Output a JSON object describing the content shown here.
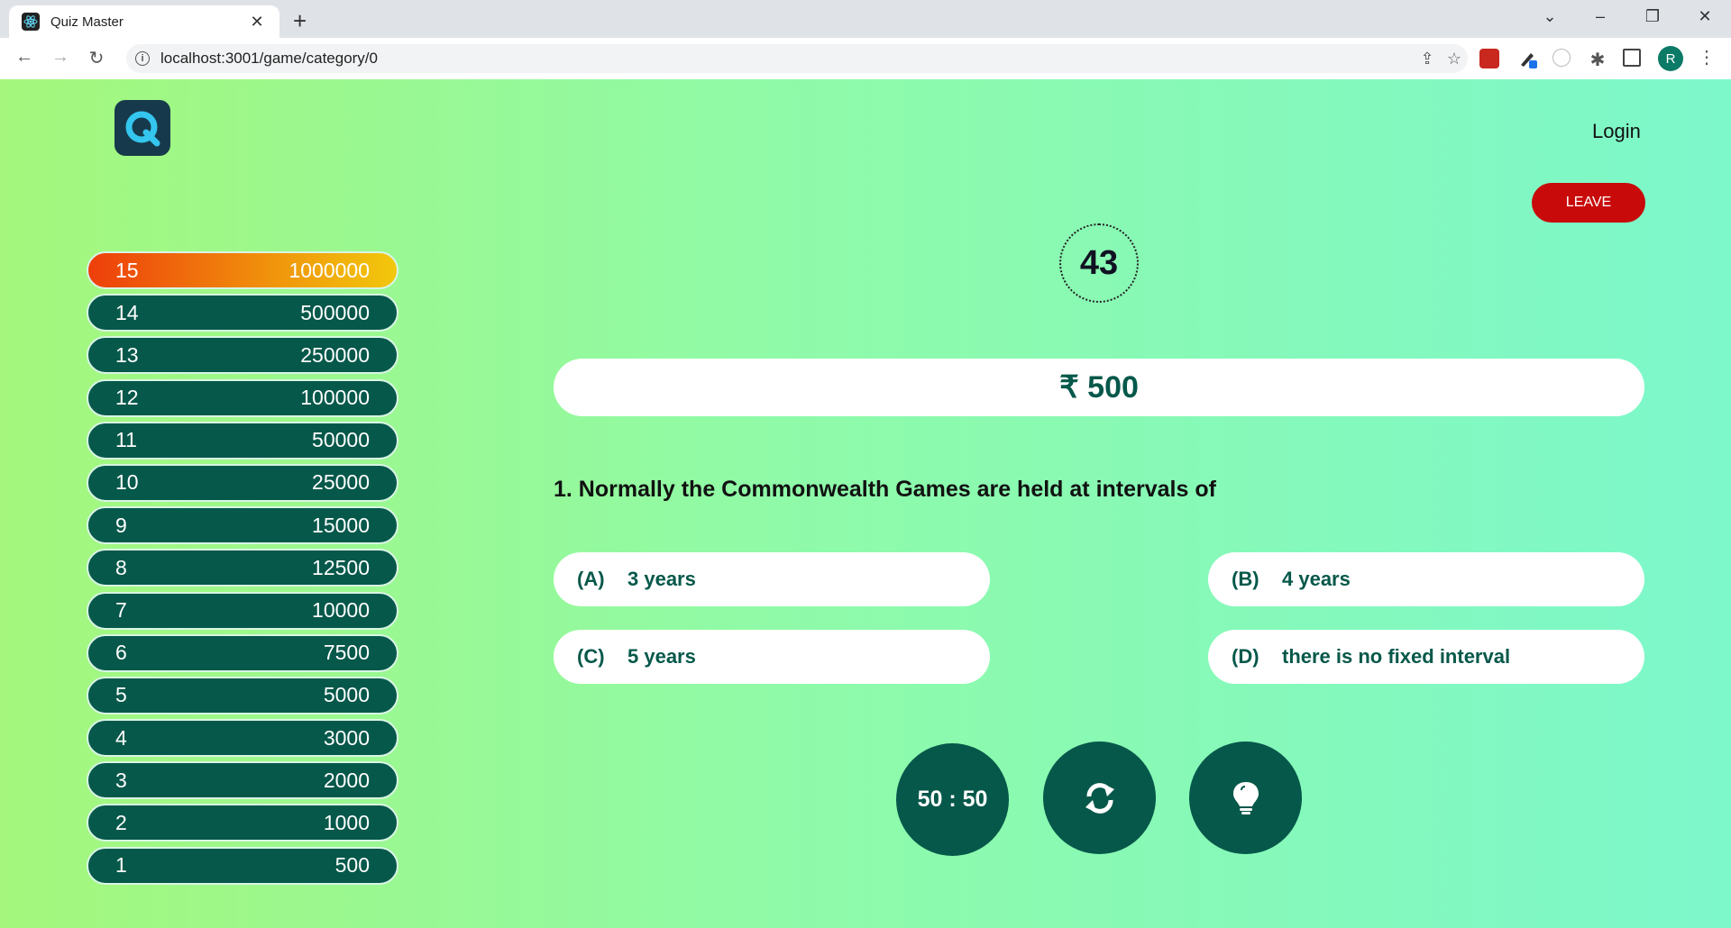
{
  "browser": {
    "tab_title": "Quiz Master",
    "new_tab_label": "+",
    "url": "localhost:3001/game/category/0",
    "profile_initial": "R"
  },
  "header": {
    "login_label": "Login",
    "leave_label": "LEAVE"
  },
  "ladder": {
    "current_level": 15,
    "rungs": [
      {
        "level": "15",
        "amount": "1000000"
      },
      {
        "level": "14",
        "amount": "500000"
      },
      {
        "level": "13",
        "amount": "250000"
      },
      {
        "level": "12",
        "amount": "100000"
      },
      {
        "level": "11",
        "amount": "50000"
      },
      {
        "level": "10",
        "amount": "25000"
      },
      {
        "level": "9",
        "amount": "15000"
      },
      {
        "level": "8",
        "amount": "12500"
      },
      {
        "level": "7",
        "amount": "10000"
      },
      {
        "level": "6",
        "amount": "7500"
      },
      {
        "level": "5",
        "amount": "5000"
      },
      {
        "level": "4",
        "amount": "3000"
      },
      {
        "level": "3",
        "amount": "2000"
      },
      {
        "level": "2",
        "amount": "1000"
      },
      {
        "level": "1",
        "amount": "500"
      }
    ]
  },
  "game": {
    "timer": "43",
    "prize": "₹ 500",
    "question": "1. Normally the Commonwealth Games are held at intervals of",
    "options": [
      {
        "letter": "(A)",
        "text": "3 years"
      },
      {
        "letter": "(B)",
        "text": "4 years"
      },
      {
        "letter": "(C)",
        "text": "5 years"
      },
      {
        "letter": "(D)",
        "text": "there is no fixed interval"
      }
    ]
  },
  "lifelines": {
    "fifty_fifty_label": "50 : 50",
    "swap_icon": "refresh-icon",
    "hint_icon": "lightbulb-icon"
  },
  "colors": {
    "primary": "#06584a",
    "leave": "#c80a0a",
    "logo_bg": "#163a4c",
    "logo_accent": "#34c6ee"
  }
}
